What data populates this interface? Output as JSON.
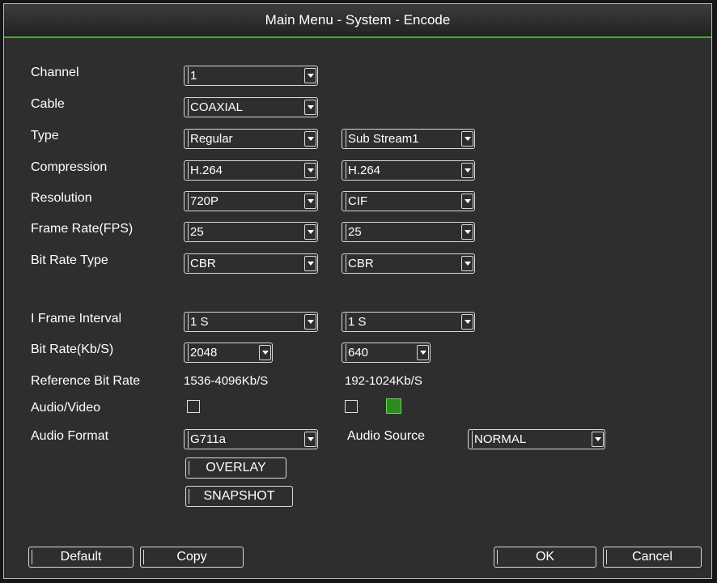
{
  "title": "Main Menu - System - Encode",
  "labels": {
    "channel": "Channel",
    "cable": "Cable",
    "type": "Type",
    "compression": "Compression",
    "resolution": "Resolution",
    "frame_rate": "Frame Rate(FPS)",
    "bit_rate_type": "Bit Rate Type",
    "i_frame_interval": "I Frame Interval",
    "bit_rate": "Bit Rate(Kb/S)",
    "reference_bit_rate": "Reference Bit Rate",
    "audio_video": "Audio/Video",
    "audio_format": "Audio Format",
    "audio_source": "Audio Source"
  },
  "main": {
    "channel": "1",
    "cable": "COAXIAL",
    "type": "Regular",
    "compression": "H.264",
    "resolution": "720P",
    "frame_rate": "25",
    "bit_rate_type": "CBR",
    "i_frame_interval": "1 S",
    "bit_rate": "2048",
    "reference_bit_rate": "1536-4096Kb/S",
    "audio_video_checked": false,
    "audio_format": "G711a"
  },
  "sub": {
    "type": "Sub Stream1",
    "compression": "H.264",
    "resolution": "CIF",
    "frame_rate": "25",
    "bit_rate_type": "CBR",
    "i_frame_interval": "1 S",
    "bit_rate": "640",
    "reference_bit_rate": "192-1024Kb/S",
    "audio_video_checked": false,
    "audio_source": "NORMAL"
  },
  "buttons": {
    "overlay": "OVERLAY",
    "snapshot": "SNAPSHOT",
    "default": "Default",
    "copy": "Copy",
    "ok": "OK",
    "cancel": "Cancel"
  },
  "colors": {
    "accent": "#3bb520",
    "panel": "#2e2e2e",
    "text": "#ffffff",
    "swatch": "#2c8a1e"
  }
}
